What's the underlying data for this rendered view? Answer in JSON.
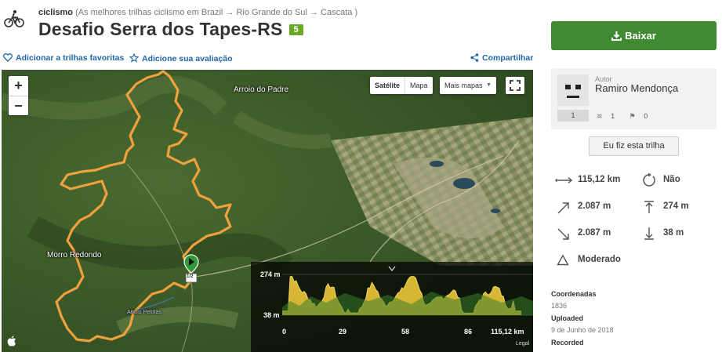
{
  "header": {
    "activity": "ciclismo",
    "breadcrumb": " (As melhores trilhas ciclismo em Brazil → Rio Grande do Sul → Cascata )",
    "title": "Desafio Serra dos Tapes-RS",
    "difficulty": "5",
    "activity_icon": "bike-icon"
  },
  "actions": {
    "favorite": "Adicionar a trilhas favoritas",
    "rate": "Adicione sua avaliação",
    "share": "Compartilhar"
  },
  "map": {
    "zoom_in": "+",
    "zoom_out": "−",
    "satellite": "Satélite",
    "map": "Mapa",
    "more_maps": "Mais mapas",
    "places": [
      "Arroio do Padre",
      "Morro Redondo",
      "Arroio Pelotas"
    ],
    "start_marker_label": "1/2",
    "legal": "Legal"
  },
  "elevation_profile": {
    "max_label": "274 m",
    "min_label": "38 m",
    "distance_ticks": [
      "0",
      "29",
      "58",
      "86",
      "115,12 km"
    ]
  },
  "sidebar": {
    "download_label": "Baixar",
    "author_label": "Autor",
    "author_name": "Ramiro Mendonça",
    "author_trails": "1",
    "author_followers": "1",
    "author_following": "0",
    "did_trail_label": "Eu fiz esta trilha",
    "stats": {
      "distance": "115,12 km",
      "loop": "Não",
      "elevation_gain": "2.087 m",
      "max_elevation": "274 m",
      "elevation_loss": "2.087 m",
      "min_elevation": "38 m",
      "difficulty": "Moderado"
    },
    "meta": {
      "coords_label": "Coordenadas",
      "coords_value": "1836",
      "uploaded_label": "Uploaded",
      "uploaded_value": "9 de Junho de 2018",
      "recorded_label": "Recorded"
    }
  },
  "colors": {
    "accent_green": "#3f8a32",
    "link_blue": "#2166a8",
    "track_orange": "#f0a03c",
    "profile_yellow": "#e8c43a"
  }
}
